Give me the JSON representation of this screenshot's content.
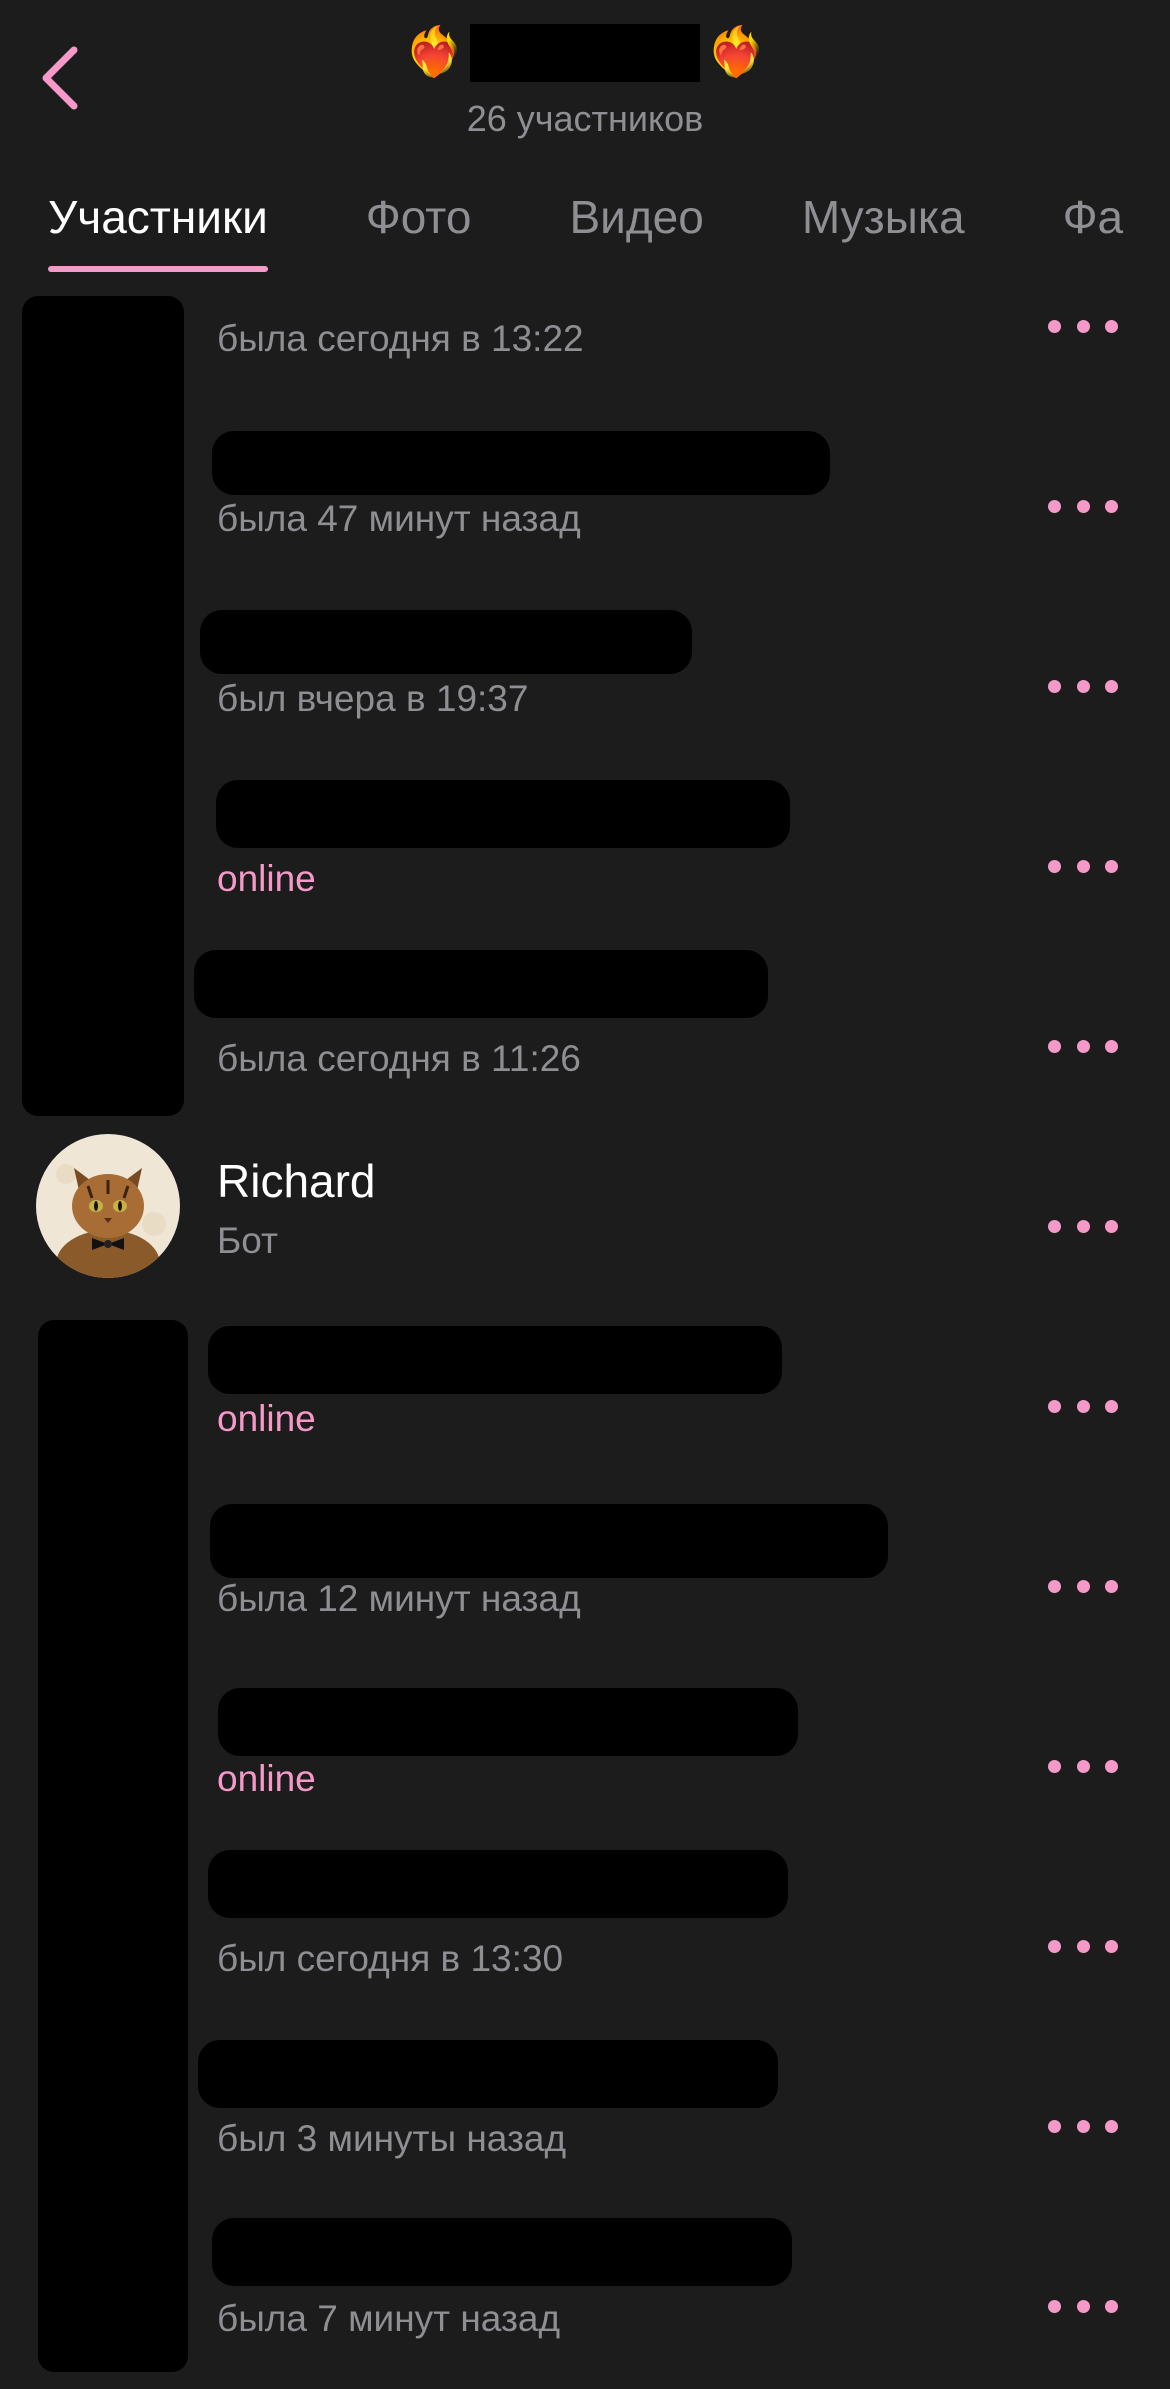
{
  "header": {
    "back_icon": "chevron-left-icon",
    "title_emoji_left": "❤️‍🔥",
    "title_emoji_right": "❤️‍🔥",
    "subtitle": "26 участников"
  },
  "tabs": [
    {
      "label": "Участники",
      "active": true
    },
    {
      "label": "Фото",
      "active": false
    },
    {
      "label": "Видео",
      "active": false
    },
    {
      "label": "Музыка",
      "active": false
    },
    {
      "label": "Фа",
      "active": false
    }
  ],
  "accent_color": "#f59ac8",
  "members": [
    {
      "name": "",
      "status": "была сегодня в 13:22",
      "online": false
    },
    {
      "name": "",
      "status": "была 47 минут назад",
      "online": false
    },
    {
      "name": "",
      "status": "был вчера в 19:37",
      "online": false
    },
    {
      "name": "",
      "status": "online",
      "online": true
    },
    {
      "name": "",
      "status": "была сегодня в 11:26",
      "online": false
    },
    {
      "name": "Richard",
      "status": "Бот",
      "online": false
    },
    {
      "name": "",
      "status": "online",
      "online": true
    },
    {
      "name": "",
      "status": "была 12 минут назад",
      "online": false
    },
    {
      "name": "",
      "status": "online",
      "online": true
    },
    {
      "name": "",
      "status": "был сегодня в 13:30",
      "online": false
    },
    {
      "name": "",
      "status": "был 3 минуты назад",
      "online": false
    },
    {
      "name": "",
      "status": "была 7 минут назад",
      "online": false
    }
  ]
}
